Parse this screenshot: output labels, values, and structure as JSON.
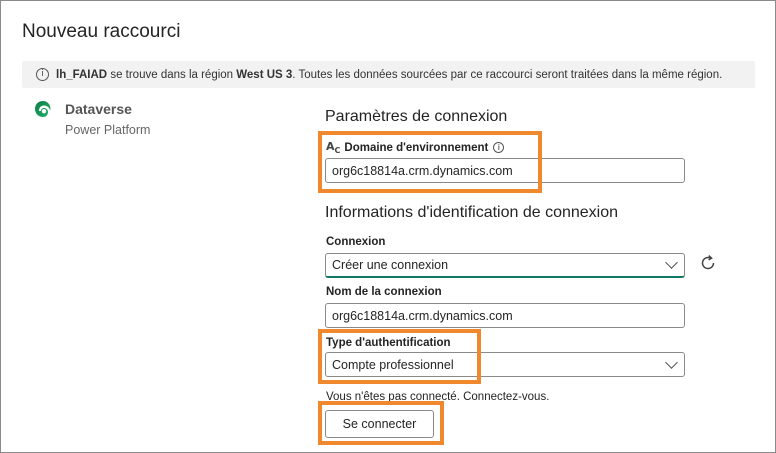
{
  "window": {
    "title": "Nouveau raccourci"
  },
  "banner": {
    "name": "lh_FAIAD",
    "text1": " se trouve dans la région ",
    "region": "West US 3",
    "text2": ". Toutes les données sourcées par ce raccourci seront traitées dans la même région."
  },
  "source": {
    "name": "Dataverse",
    "subtitle": "Power Platform"
  },
  "connection_settings": {
    "heading": "Paramètres de connexion",
    "env_domain_label": "Domaine d'environnement",
    "env_domain_value": "org6c18814a.crm.dynamics.com"
  },
  "credentials": {
    "heading": "Informations d'identification de connexion",
    "connection_label": "Connexion",
    "connection_value": "Créer une connexion",
    "connection_name_label": "Nom de la connexion",
    "connection_name_value": "org6c18814a.crm.dynamics.com",
    "auth_type_label": "Type d'authentification",
    "auth_type_value": "Compte professionnel",
    "signin_note": "Vous n'êtes pas connecté. Connectez-vous.",
    "signin_button": "Se connecter"
  },
  "colors": {
    "highlight": "#f0892d",
    "accent": "#117865"
  },
  "icons": [
    "info-icon",
    "dataverse-logo-icon",
    "text-field-icon",
    "chevron-down-icon",
    "refresh-icon"
  ]
}
